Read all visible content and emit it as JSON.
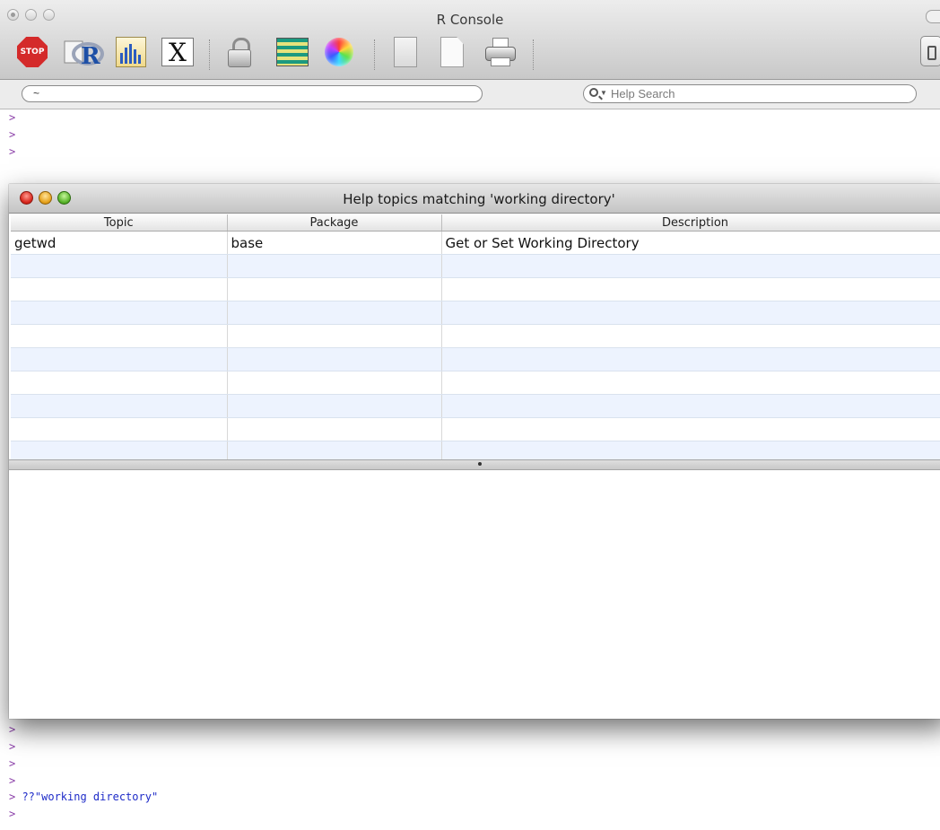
{
  "console": {
    "title": "R Console",
    "working_dir": "~",
    "help_search_placeholder": "Help Search",
    "toolbar": {
      "stop_label": "STOP",
      "x11_label": "X"
    },
    "lines_top": [
      ">",
      ">",
      ">"
    ],
    "lines_bottom": [
      ">",
      ">",
      ">",
      ">"
    ],
    "command": "??\"working directory\"",
    "last_prompt": ">"
  },
  "help_window": {
    "title": "Help topics matching 'working directory'",
    "columns": [
      "Topic",
      "Package",
      "Description"
    ],
    "rows": [
      {
        "topic": "getwd",
        "package": "base",
        "description": "Get or Set Working Directory"
      }
    ]
  }
}
